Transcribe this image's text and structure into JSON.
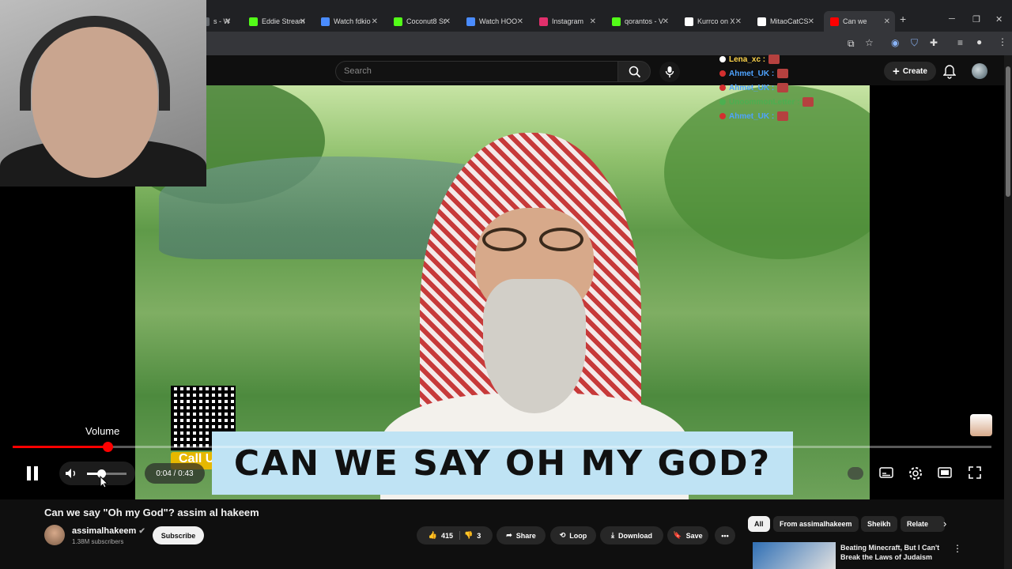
{
  "browser": {
    "tabs": [
      {
        "label": "s - W",
        "color": "#5f6368"
      },
      {
        "label": "Eddie Stream",
        "color": "#53fc18"
      },
      {
        "label": "Watch fdkio",
        "color": "#4a8cff"
      },
      {
        "label": "Coconut8 St",
        "color": "#53fc18"
      },
      {
        "label": "Watch HOO",
        "color": "#4a8cff"
      },
      {
        "label": "Instagram",
        "color": "#e1306c"
      },
      {
        "label": "qorantos - V",
        "color": "#53fc18"
      },
      {
        "label": "Kurrco on X",
        "color": "#ffffff"
      },
      {
        "label": "MitaoCatCS",
        "color": "#ffffff"
      },
      {
        "label": "Can we",
        "color": "#ff0000"
      }
    ],
    "new_tab": "+",
    "window_controls": [
      "─",
      "❐",
      "✕"
    ]
  },
  "youtube": {
    "search_placeholder": "Search",
    "create_label": "Create"
  },
  "chat_overlay": [
    {
      "user": "Lena_xc",
      "color": "#ffd54a",
      "dot": "#ffffff"
    },
    {
      "user": "Ahmet_UK",
      "color": "#4ea3ff",
      "dot": "#d32f2f"
    },
    {
      "user": "Ahmet_UK",
      "color": "#4ea3ff",
      "dot": "#d32f2f"
    },
    {
      "user": "UnoommonLetter",
      "color": "#4caf50",
      "dot": "#4caf50"
    },
    {
      "user": "Ahmet_UK",
      "color": "#4ea3ff",
      "dot": "#d32f2f"
    }
  ],
  "video": {
    "banner_text": "CAN WE SAY OH MY GOD?",
    "call_text": "Call U"
  },
  "player": {
    "tooltip": "Volume",
    "time": "0:04 / 0:43",
    "progress": 0.097,
    "volume": 0.35,
    "accent": "#ff0000"
  },
  "info": {
    "title": "Can we say \"Oh my God\"? assim al hakeem",
    "channel": "assimalhakeem",
    "subscribers": "1.38M subscribers",
    "subscribe": "Subscribe",
    "likes": "415",
    "dislikes": "3",
    "share": "Share",
    "loop": "Loop",
    "download": "Download",
    "save": "Save"
  },
  "chips": [
    "All",
    "From assimalhakeem",
    "Sheikh",
    "Relate"
  ],
  "recommendation": {
    "title": "Beating Minecraft, But I Can't Break the Laws of Judaism"
  }
}
